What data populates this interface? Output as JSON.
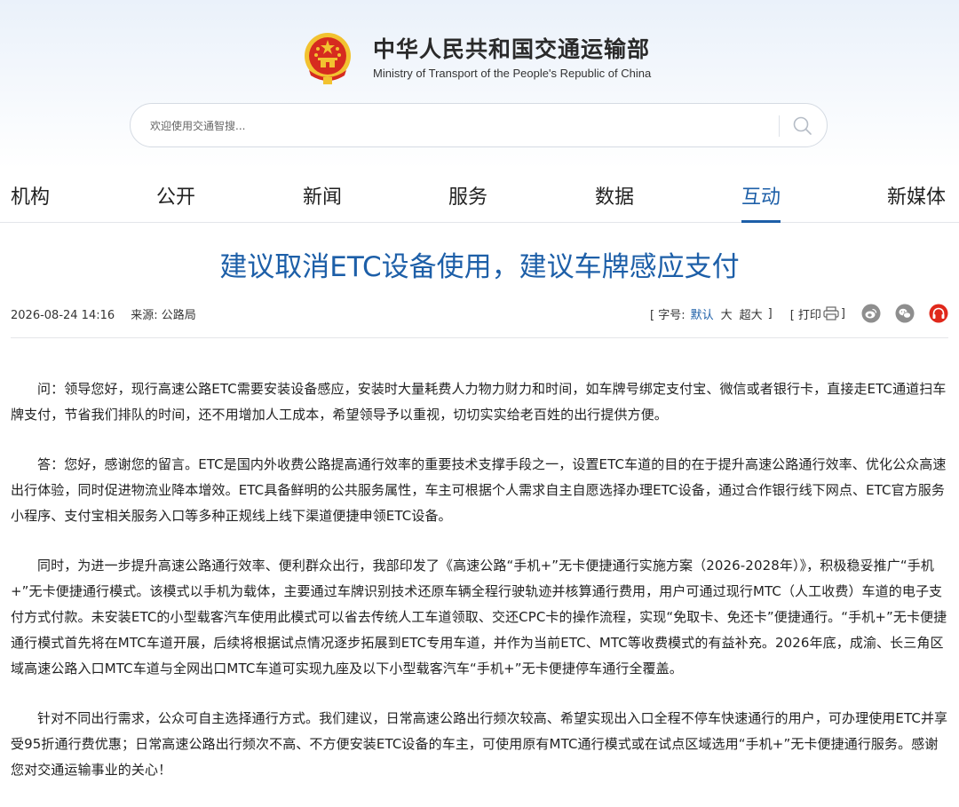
{
  "site": {
    "name_cn": "中华人民共和国交通运输部",
    "name_en": "Ministry of Transport of the People's Republic of China"
  },
  "search": {
    "placeholder": "欢迎使用交通智搜..."
  },
  "nav": {
    "items": [
      {
        "label": "机构"
      },
      {
        "label": "公开"
      },
      {
        "label": "新闻"
      },
      {
        "label": "服务"
      },
      {
        "label": "数据"
      },
      {
        "label": "互动",
        "active": true
      },
      {
        "label": "新媒体"
      }
    ]
  },
  "article": {
    "title": "建议取消ETC设备使用，建议车牌感应支付",
    "date": "2026-08-24 14:16",
    "source": "来源: 公路局",
    "font_size": {
      "label": "[ 字号:",
      "options": [
        "默认",
        "大",
        "超大"
      ],
      "selected": "默认",
      "close": "]"
    },
    "print": {
      "label": "[ 打印",
      "close": "]"
    },
    "paragraphs": [
      "问：领导您好，现行高速公路ETC需要安装设备感应，安装时大量耗费人力物力财力和时间，如车牌号绑定支付宝、微信或者银行卡，直接走ETC通道扫车牌支付，节省我们排队的时间，还不用增加人工成本，希望领导予以重视，切切实实给老百姓的出行提供方便。",
      "答：您好，感谢您的留言。ETC是国内外收费公路提高通行效率的重要技术支撑手段之一，设置ETC车道的目的在于提升高速公路通行效率、优化公众高速出行体验，同时促进物流业降本增效。ETC具备鲜明的公共服务属性，车主可根据个人需求自主自愿选择办理ETC设备，通过合作银行线下网点、ETC官方服务小程序、支付宝相关服务入口等多种正规线上线下渠道便捷申领ETC设备。",
      "同时，为进一步提升高速公路通行效率、便利群众出行，我部印发了《高速公路“手机+”无卡便捷通行实施方案（2026-2028年）》，积极稳妥推广“手机+”无卡便捷通行模式。该模式以手机为载体，主要通过车牌识别技术还原车辆全程行驶轨迹并核算通行费用，用户可通过现行MTC（人工收费）车道的电子支付方式付款。未安装ETC的小型载客汽车使用此模式可以省去传统人工车道领取、交还CPC卡的操作流程，实现“免取卡、免还卡”便捷通行。“手机+”无卡便捷通行模式首先将在MTC车道开展，后续将根据试点情况逐步拓展到ETC专用车道，并作为当前ETC、MTC等收费模式的有益补充。2026年底，成渝、长三角区域高速公路入口MTC车道与全网出口MTC车道可实现九座及以下小型载客汽车“手机+”无卡便捷停车通行全覆盖。",
      "针对不同出行需求，公众可自主选择通行方式。我们建议，日常高速公路出行频次较高、希望实现出入口全程不停车快速通行的用户，可办理使用ETC并享受95折通行费优惠；日常高速公路出行频次不高、不方便安装ETC设备的车主，可使用原有MTC通行模式或在试点区域选用“手机+”无卡便捷通行服务。感谢您对交通运输事业的关心！"
    ]
  },
  "colors": {
    "accent": "#1d5fa8",
    "emblem_red": "#d62b1f",
    "emblem_gold": "#f2c230"
  },
  "icons": [
    "national-emblem-icon",
    "search-icon",
    "printer-icon",
    "weibo-icon",
    "wechat-icon",
    "headphones-icon"
  ]
}
